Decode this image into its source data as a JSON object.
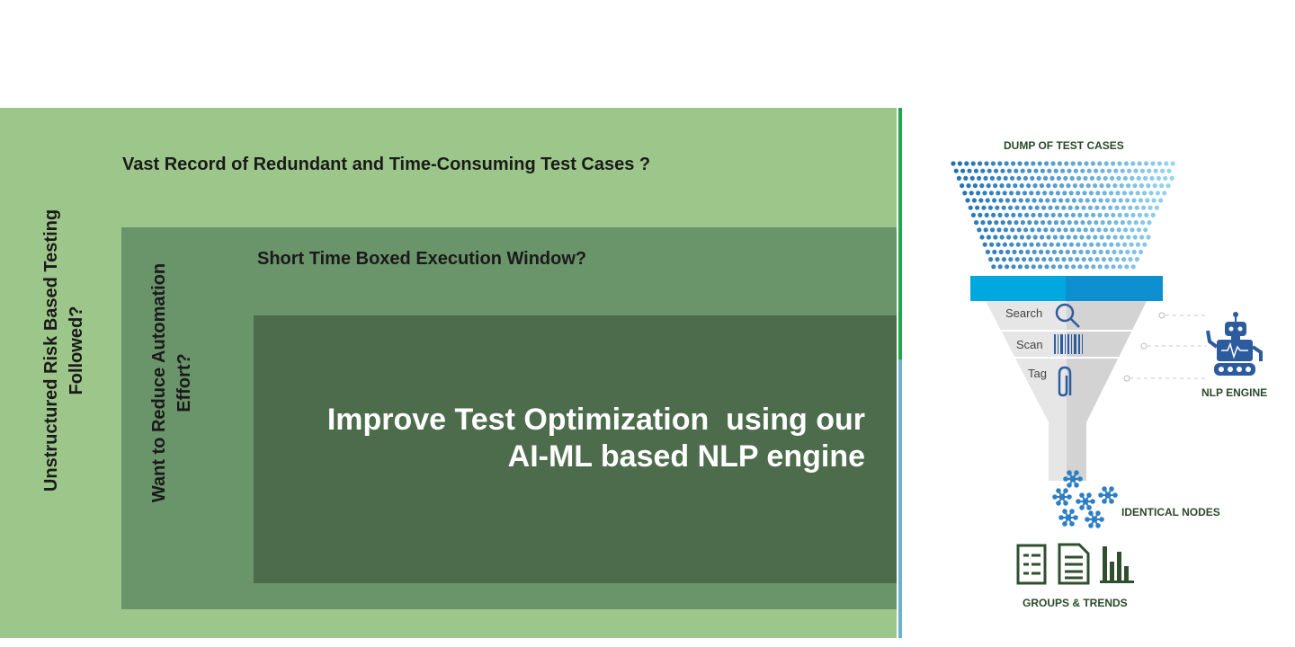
{
  "left_panel": {
    "outer_vertical_label": "Unstructured Risk Based Testing Followed?",
    "outer_heading": "Vast Record of Redundant and Time-Consuming Test Cases ?",
    "middle_vertical_label": "Want to Reduce Automation Effort?",
    "middle_heading": "Short Time Boxed Execution Window?",
    "main_line1": "Improve Test Optimization  using our",
    "main_line2": "AI-ML based NLP engine"
  },
  "funnel": {
    "top_label": "DUMP OF TEST CASES",
    "steps": [
      {
        "label": "Search",
        "icon": "magnifier-icon"
      },
      {
        "label": "Scan",
        "icon": "barcode-icon"
      },
      {
        "label": "Tag",
        "icon": "paperclip-icon"
      }
    ],
    "engine_label": "NLP ENGINE",
    "nodes_label": "IDENTICAL NODES",
    "groups_label": "GROUPS & TRENDS"
  },
  "colors": {
    "outer": "#9dc78a",
    "middle": "#6a946a",
    "inner": "#4c6c4c",
    "funnel_rim": "#00a8e0",
    "dot_dark": "#1f6fb5",
    "dot_light": "#9ad8f0",
    "icon_blue": "#2d5c9e",
    "icon_green": "#2f4f2f"
  }
}
